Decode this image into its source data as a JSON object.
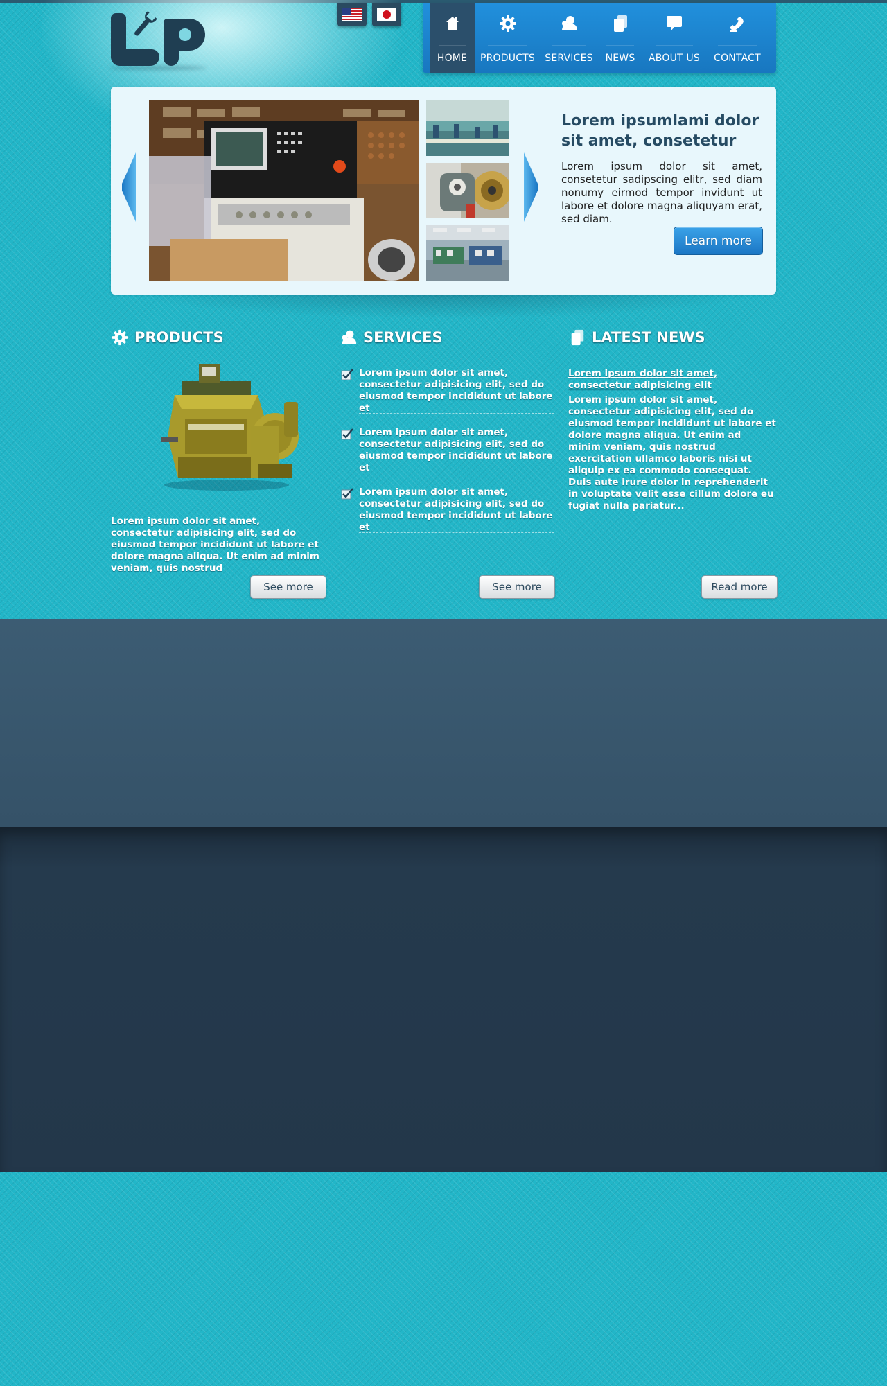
{
  "header": {
    "logo_alt": "LP",
    "languages": [
      {
        "name": "English",
        "icon": "us-flag-icon"
      },
      {
        "name": "Japanese",
        "icon": "japan-flag-icon"
      }
    ]
  },
  "nav": {
    "items": [
      {
        "label": "HOME",
        "icon": "home-icon",
        "active": true
      },
      {
        "label": "PRODUCTS",
        "icon": "gear-icon",
        "active": false
      },
      {
        "label": "SERVICES",
        "icon": "person-icon",
        "active": false
      },
      {
        "label": "NEWS",
        "icon": "document-icon",
        "active": false
      },
      {
        "label": "ABOUT US",
        "icon": "speech-bubble-icon",
        "active": false
      },
      {
        "label": "CONTACT",
        "icon": "phone-icon",
        "active": false
      }
    ]
  },
  "slider": {
    "title": "Lorem ipsumlami dolor sit amet, consetetur",
    "text": "Lorem ipsum dolor sit amet, consetetur sadipscing elitr, sed diam nonumy eirmod tempor invidunt ut labore et dolore magna aliquyam erat, sed diam.",
    "button_label": "Learn more"
  },
  "products": {
    "heading": "PRODUCTS",
    "text": "Lorem ipsum dolor sit amet, consectetur adipisicing elit, sed do eiusmod tempor incididunt ut labore et dolore magna aliqua. Ut enim ad minim veniam, quis nostrud",
    "button_label": "See more"
  },
  "services": {
    "heading": "SERVICES",
    "items": [
      "Lorem ipsum dolor sit amet, consectetur adipisicing elit, sed do eiusmod tempor incididunt ut labore et",
      "Lorem ipsum dolor sit amet, consectetur adipisicing elit, sed do eiusmod tempor incididunt ut labore et",
      "Lorem ipsum dolor sit amet, consectetur adipisicing elit, sed do eiusmod tempor incididunt ut labore et"
    ],
    "button_label": "See more"
  },
  "news": {
    "heading": "LATEST NEWS",
    "link": "Lorem ipsum dolor sit amet, consectetur adipisicing elit",
    "text": "Lorem ipsum dolor sit amet, consectetur adipisicing elit, sed do eiusmod tempor incididunt ut labore et dolore magna aliqua. Ut enim ad minim veniam, quis nostrud exercitation ullamco laboris nisi ut aliquip ex ea commodo consequat. Duis aute irure dolor in reprehenderit in voluptate velit esse cillum dolore eu fugiat nulla pariatur...",
    "button_label": "Read more"
  },
  "colors": {
    "background": "#22b6c8",
    "nav": "#1a82cc",
    "nav_active": "#2b4f6b",
    "accent_button": "#2a8ed8",
    "footer_top": "#3a5a70",
    "footer_bottom": "#23374a"
  }
}
